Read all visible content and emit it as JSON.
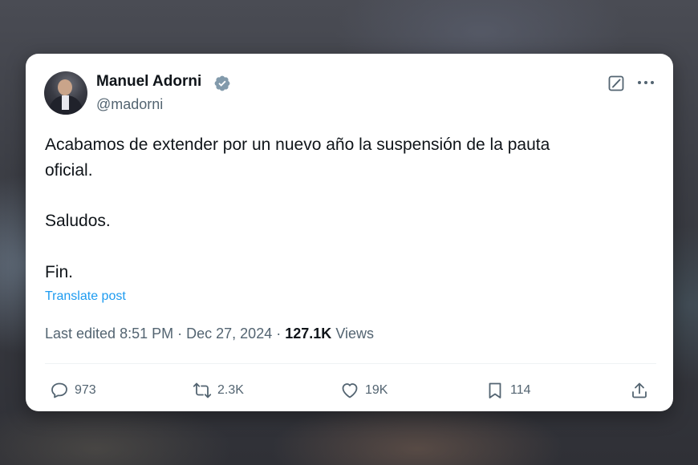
{
  "post": {
    "author_name": "Manuel Adorni",
    "author_handle": "@madorni",
    "verified": true,
    "text_lines": [
      "Acabamos de extender por un nuevo año la suspensión de la pauta",
      "oficial.",
      "Saludos.",
      "Fin."
    ],
    "translate_label": "Translate post",
    "edited_label": "Last edited 8:51 PM",
    "separator": "·",
    "date": "Dec 27, 2024",
    "views_count": "127.1K",
    "views_label": "Views"
  },
  "actions": {
    "replies": "973",
    "reposts": "2.3K",
    "likes": "19K",
    "bookmarks": "114"
  },
  "icons": {
    "verified": "verified-badge-icon",
    "grok": "grok-icon",
    "more": "more-options-icon",
    "reply": "reply-icon",
    "repost": "repost-icon",
    "like": "heart-icon",
    "bookmark": "bookmark-icon",
    "share": "share-icon"
  },
  "colors": {
    "accent": "#1d9bf0",
    "text_primary": "#0f1419",
    "text_secondary": "#536471",
    "verified_badge": "#829aab"
  }
}
